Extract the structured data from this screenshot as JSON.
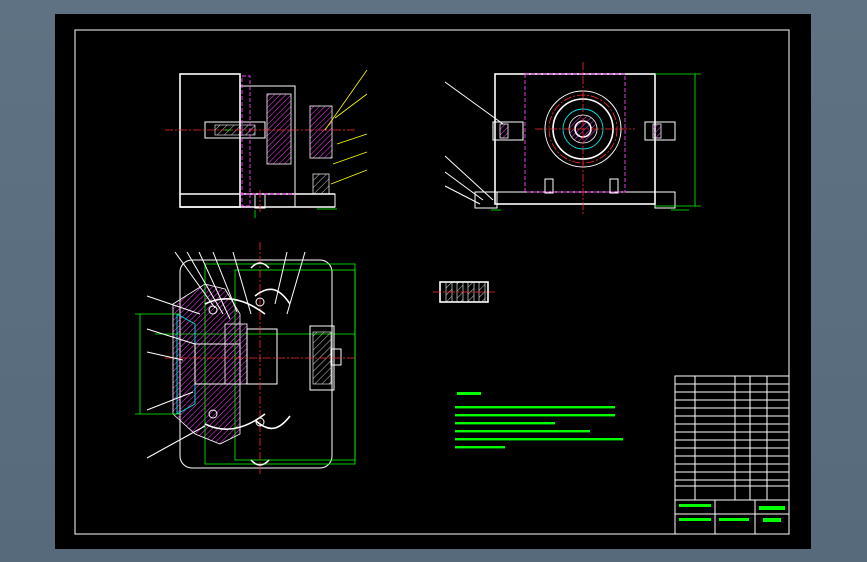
{
  "drawing": {
    "colors": {
      "background": "#000000",
      "outline": "#ffffff",
      "hidden_line": "#ff3cff",
      "center_line": "#ff2a2a",
      "dimension": "#00ff00",
      "section": "#00e6e6",
      "leader": "#ffff00"
    }
  }
}
